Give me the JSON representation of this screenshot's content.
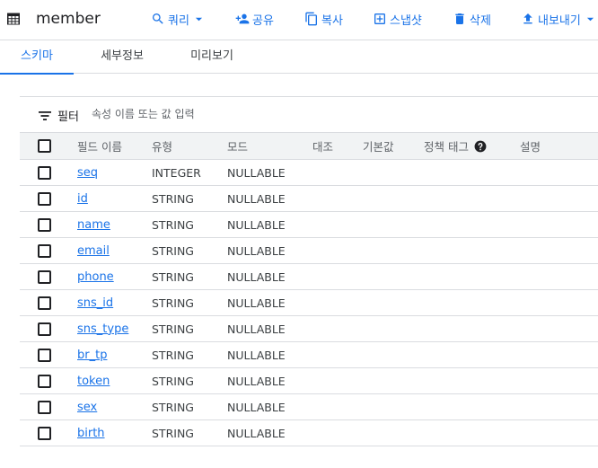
{
  "header": {
    "title": "member",
    "icons": {
      "table": "table-grid-icon"
    },
    "actions": [
      {
        "id": "query",
        "label": "쿼리",
        "icon": "search-icon",
        "has_dropdown": true
      },
      {
        "id": "share",
        "label": "공유",
        "icon": "person-add-icon"
      },
      {
        "id": "copy",
        "label": "복사",
        "icon": "copy-icon"
      },
      {
        "id": "snapshot",
        "label": "스냅샷",
        "icon": "add-box-icon"
      },
      {
        "id": "delete",
        "label": "삭제",
        "icon": "trash-icon"
      },
      {
        "id": "export",
        "label": "내보내기",
        "icon": "upload-icon",
        "has_dropdown": true
      }
    ]
  },
  "tabs": [
    {
      "label": "스키마",
      "active": true
    },
    {
      "label": "세부정보",
      "active": false
    },
    {
      "label": "미리보기",
      "active": false
    }
  ],
  "filter": {
    "label": "필터",
    "placeholder": "속성 이름 또는 값 입력",
    "value": ""
  },
  "schema": {
    "columns": [
      "필드 이름",
      "유형",
      "모드",
      "대조",
      "기본값",
      "정책 태그",
      "설명"
    ],
    "policy_tag_help_icon": "help-circle-icon",
    "rows": [
      {
        "name": "seq",
        "type": "INTEGER",
        "mode": "NULLABLE",
        "checked": false
      },
      {
        "name": "id",
        "type": "STRING",
        "mode": "NULLABLE",
        "checked": false
      },
      {
        "name": "name",
        "type": "STRING",
        "mode": "NULLABLE",
        "checked": false
      },
      {
        "name": "email",
        "type": "STRING",
        "mode": "NULLABLE",
        "checked": false
      },
      {
        "name": "phone",
        "type": "STRING",
        "mode": "NULLABLE",
        "checked": false
      },
      {
        "name": "sns_id",
        "type": "STRING",
        "mode": "NULLABLE",
        "checked": false
      },
      {
        "name": "sns_type",
        "type": "STRING",
        "mode": "NULLABLE",
        "checked": false
      },
      {
        "name": "br_tp",
        "type": "STRING",
        "mode": "NULLABLE",
        "checked": false
      },
      {
        "name": "token",
        "type": "STRING",
        "mode": "NULLABLE",
        "checked": false
      },
      {
        "name": "sex",
        "type": "STRING",
        "mode": "NULLABLE",
        "checked": false
      },
      {
        "name": "birth",
        "type": "STRING",
        "mode": "NULLABLE",
        "checked": false
      }
    ]
  },
  "colors": {
    "accent": "#1a73e8",
    "text": "#202124",
    "muted": "#5f6368",
    "divider": "#dadce0",
    "header_bg": "#f1f3f4"
  }
}
